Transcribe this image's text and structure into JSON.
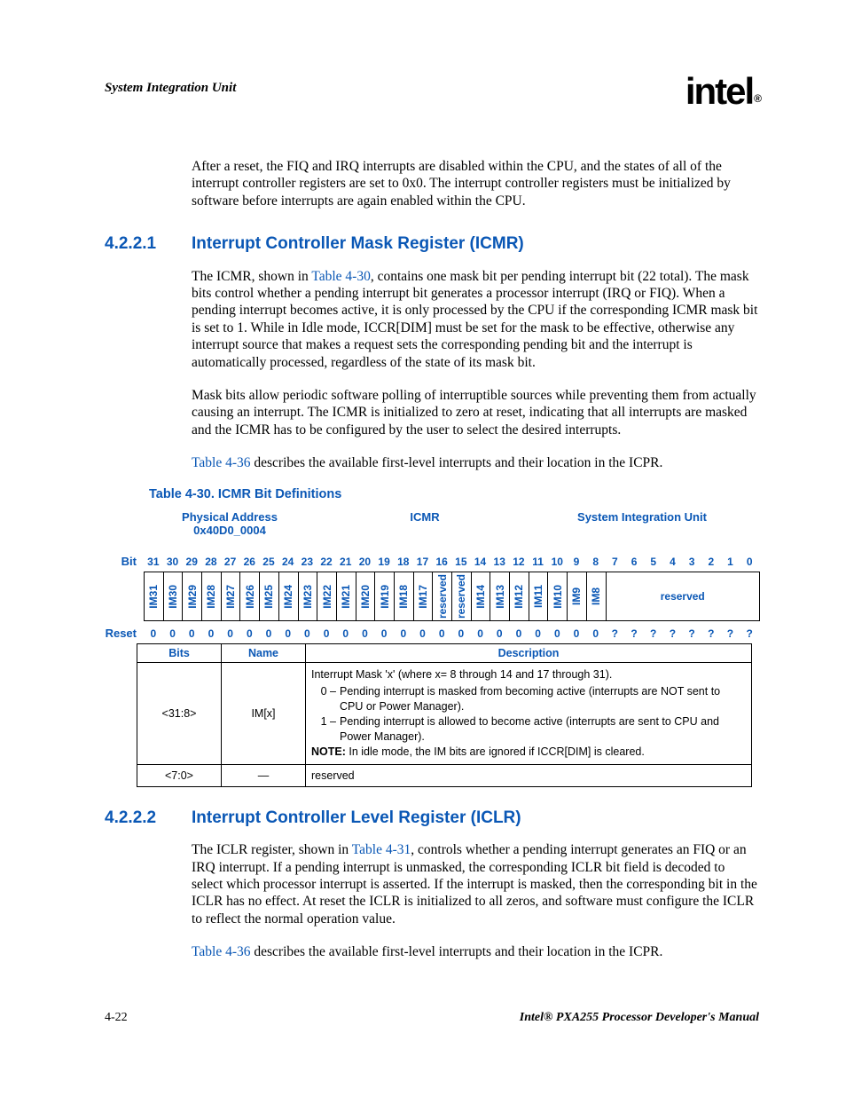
{
  "header": {
    "running_head": "System Integration Unit",
    "logo_text": "intel",
    "logo_r": "®"
  },
  "intro_p1": "After a reset, the FIQ and IRQ interrupts are disabled within the CPU, and the states of all of the interrupt controller registers are set to 0x0. The interrupt controller registers must be initialized by software before interrupts are again enabled within the CPU.",
  "sec1": {
    "num": "4.2.2.1",
    "title": "Interrupt Controller Mask Register (ICMR)",
    "p1a": "The ICMR, shown in ",
    "p1_link": "Table 4-30",
    "p1b": ", contains one mask bit per pending interrupt bit (22 total). The mask bits control whether a pending interrupt bit generates a processor interrupt (IRQ or FIQ). When a pending interrupt becomes active, it is only processed by the CPU if the corresponding ICMR mask bit is set to 1. While in Idle mode, ICCR[DIM] must be set for the mask to be effective, otherwise any interrupt source that makes a request sets the corresponding pending bit and the interrupt is automatically processed, regardless of the state of its mask bit.",
    "p2": "Mask bits allow periodic software polling of interruptible sources while preventing them from actually causing an interrupt. The ICMR is initialized to zero at reset, indicating that all interrupts are masked and the ICMR has to be configured by the user to select the desired interrupts.",
    "p3_link": "Table 4-36",
    "p3b": " describes the available first-level interrupts and their location in the ICPR."
  },
  "table": {
    "caption": "Table 4-30. ICMR Bit Definitions",
    "phys_label": "Physical Address",
    "phys_addr": "0x40D0_0004",
    "reg_name": "ICMR",
    "unit": "System Integration Unit",
    "bit_label": "Bit",
    "reset_label": "Reset",
    "bits": [
      "31",
      "30",
      "29",
      "28",
      "27",
      "26",
      "25",
      "24",
      "23",
      "22",
      "21",
      "20",
      "19",
      "18",
      "17",
      "16",
      "15",
      "14",
      "13",
      "12",
      "11",
      "10",
      "9",
      "8",
      "7",
      "6",
      "5",
      "4",
      "3",
      "2",
      "1",
      "0"
    ],
    "fields": [
      {
        "label": "IM31",
        "span": 1,
        "rot": true
      },
      {
        "label": "IM30",
        "span": 1,
        "rot": true
      },
      {
        "label": "IM29",
        "span": 1,
        "rot": true
      },
      {
        "label": "IM28",
        "span": 1,
        "rot": true
      },
      {
        "label": "IM27",
        "span": 1,
        "rot": true
      },
      {
        "label": "IM26",
        "span": 1,
        "rot": true
      },
      {
        "label": "IM25",
        "span": 1,
        "rot": true
      },
      {
        "label": "IM24",
        "span": 1,
        "rot": true
      },
      {
        "label": "IM23",
        "span": 1,
        "rot": true
      },
      {
        "label": "IM22",
        "span": 1,
        "rot": true
      },
      {
        "label": "IM21",
        "span": 1,
        "rot": true
      },
      {
        "label": "IM20",
        "span": 1,
        "rot": true
      },
      {
        "label": "IM19",
        "span": 1,
        "rot": true
      },
      {
        "label": "IM18",
        "span": 1,
        "rot": true
      },
      {
        "label": "IM17",
        "span": 1,
        "rot": true
      },
      {
        "label": "reserved",
        "span": 1,
        "rot": true
      },
      {
        "label": "reserved",
        "span": 1,
        "rot": true
      },
      {
        "label": "IM14",
        "span": 1,
        "rot": true
      },
      {
        "label": "IM13",
        "span": 1,
        "rot": true
      },
      {
        "label": "IM12",
        "span": 1,
        "rot": true
      },
      {
        "label": "IM11",
        "span": 1,
        "rot": true
      },
      {
        "label": "IM10",
        "span": 1,
        "rot": true
      },
      {
        "label": "IM9",
        "span": 1,
        "rot": true
      },
      {
        "label": "IM8",
        "span": 1,
        "rot": true
      },
      {
        "label": "reserved",
        "span": 8,
        "rot": false
      }
    ],
    "reset": [
      "0",
      "0",
      "0",
      "0",
      "0",
      "0",
      "0",
      "0",
      "0",
      "0",
      "0",
      "0",
      "0",
      "0",
      "0",
      "0",
      "0",
      "0",
      "0",
      "0",
      "0",
      "0",
      "0",
      "0",
      "?",
      "?",
      "?",
      "?",
      "?",
      "?",
      "?",
      "?"
    ],
    "hdr_bits": "Bits",
    "hdr_name": "Name",
    "hdr_desc": "Description",
    "rows": [
      {
        "bits": "<31:8>",
        "name": "IM[x]",
        "desc_line1": "Interrupt Mask 'x' (where x= 8 through 14 and 17 through 31).",
        "desc_opt0_n": "0 –",
        "desc_opt0": "Pending interrupt is masked from becoming active (interrupts are NOT sent to CPU or Power Manager).",
        "desc_opt1_n": "1 –",
        "desc_opt1": "Pending interrupt is allowed to become active (interrupts are sent to CPU and Power Manager).",
        "note_label": "NOTE:",
        "note": " In idle mode, the IM bits are ignored if ICCR[DIM] is cleared."
      },
      {
        "bits": "<7:0>",
        "name": "—",
        "desc": "reserved"
      }
    ]
  },
  "sec2": {
    "num": "4.2.2.2",
    "title": "Interrupt Controller Level Register (ICLR)",
    "p1a": "The ICLR register, shown in ",
    "p1_link": "Table 4-31",
    "p1b": ", controls whether a pending interrupt generates an FIQ or an IRQ interrupt. If a pending interrupt is unmasked, the corresponding ICLR bit field is decoded to select which processor interrupt is asserted. If the interrupt is masked, then the corresponding bit in the ICLR has no effect. At reset the ICLR is initialized to all zeros, and software must configure the ICLR to reflect the normal operation value.",
    "p2_link": "Table 4-36",
    "p2b": " describes the available first-level interrupts and their location in the ICPR."
  },
  "footer": {
    "page": "4-22",
    "manual": "Intel® PXA255 Processor Developer's Manual"
  }
}
